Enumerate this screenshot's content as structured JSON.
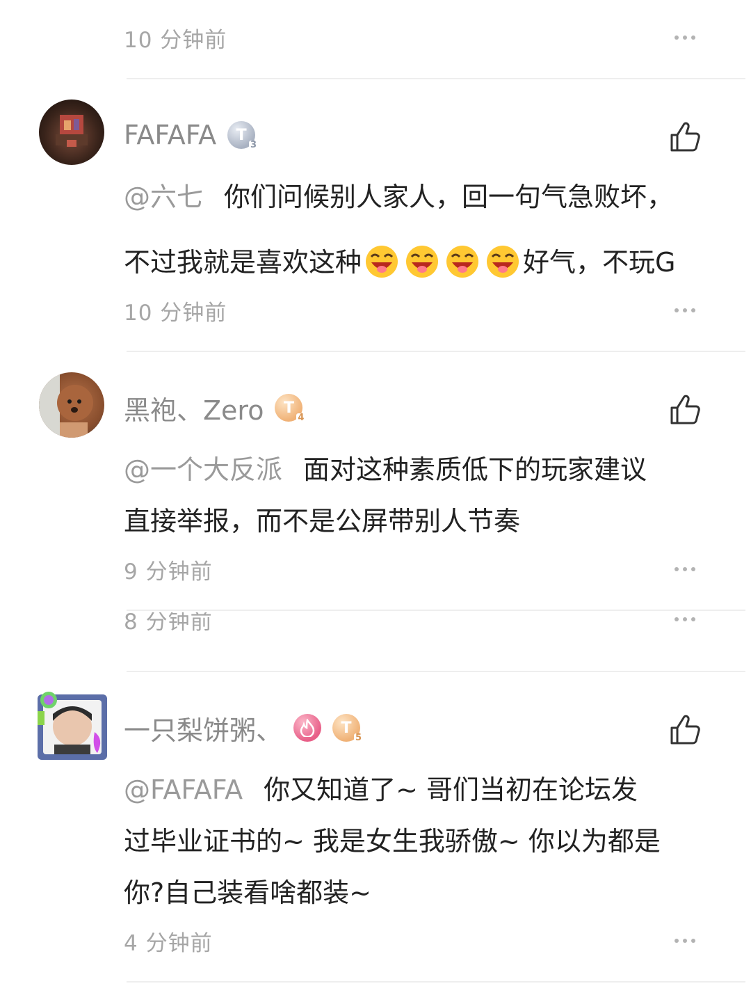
{
  "top_comment": {
    "time": "10 分钟前"
  },
  "comments": [
    {
      "username": "FAFAFA",
      "level_badge": {
        "label": "T",
        "level": "3",
        "color": "#a9b2c2"
      },
      "mention": "@六七",
      "line1": "你们问候别人家人，回一句气急败坏，",
      "line2_before": "不过我就是喜欢这种",
      "line2_after": "好气，不玩G",
      "emoji_icon": "laughing-tongue-emoji",
      "emoji_count": 4,
      "time": "10 分钟前"
    },
    {
      "username": "黑袍、Zero",
      "level_badge": {
        "label": "T",
        "level": "4",
        "color": "#f0b277"
      },
      "mention": "@一个大反派",
      "line1": "面对这种素质低下的玩家建议",
      "line2": "直接举报，而不是公屏带别人节奏",
      "time": "9 分钟前"
    },
    {
      "hidden_time": "8 分钟前"
    },
    {
      "username": "一只梨饼粥、",
      "flame_badge_icon": "flame-icon",
      "level_badge": {
        "label": "T",
        "level": "5",
        "color": "#f0b277"
      },
      "mention": "@FAFAFA",
      "line1": "你又知道了~ 哥们当初在论坛发",
      "line2": "过毕业证书的~ 我是女生我骄傲~ 你以为都是",
      "line3": "你?自己装看啥都装~",
      "time": "4 分钟前"
    }
  ],
  "colors": {
    "muted": "#9a9a9a",
    "text": "#222222",
    "divider": "#eeeeee"
  }
}
